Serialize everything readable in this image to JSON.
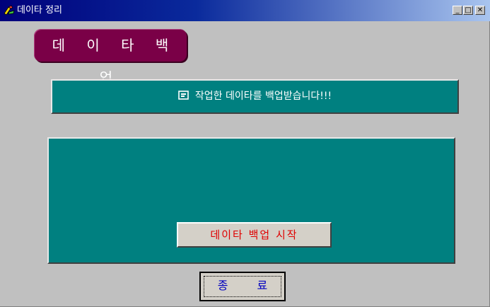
{
  "window": {
    "title": "데이타 정리",
    "controls": {
      "minimize": "_",
      "maximize": "□",
      "close": "✕"
    }
  },
  "banner": {
    "label": "데 이 타 백 업"
  },
  "info": {
    "icon": "memo-icon",
    "message": "작업한 데이타를 백업받습니다!!!"
  },
  "actions": {
    "start_label": "데이타 백업 시작",
    "exit_label": "종 료"
  },
  "colors": {
    "title_gradient_start": "#00007b",
    "title_gradient_end": "#a9c5ef",
    "banner": "#7a0047",
    "panel": "#008080",
    "start_text": "#e00000",
    "exit_text": "#0000c0",
    "window_bg": "#c0c0c0"
  }
}
